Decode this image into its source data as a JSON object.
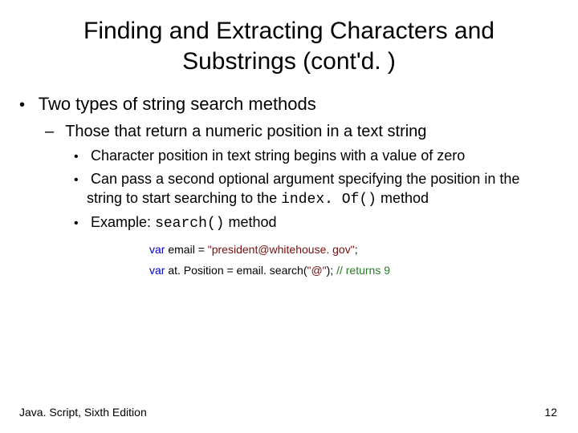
{
  "title": "Finding and Extracting Characters and Substrings (cont'd. )",
  "bullet1": "Two types of string search methods",
  "bullet2": "Those that return a numeric position in a text string",
  "bullet3a": "Character position in text string begins with a value of zero",
  "bullet3b_pre": "Can pass a second optional argument specifying the position in the string to start searching to the ",
  "bullet3b_code": "index. Of()",
  "bullet3b_post": " method",
  "bullet3c_pre": "Example: ",
  "bullet3c_code": "search()",
  "bullet3c_post": " method",
  "code": {
    "line1": {
      "kw": "var",
      "mid": " email = ",
      "str": "\"president@whitehouse. gov\"",
      "end": "; "
    },
    "line2": {
      "kw": "var",
      "mid": " at. Position = email. search(",
      "str": "\"@\"",
      "end": "); ",
      "com": "// returns 9"
    }
  },
  "footer_left": "Java. Script, Sixth Edition",
  "footer_right": "12"
}
